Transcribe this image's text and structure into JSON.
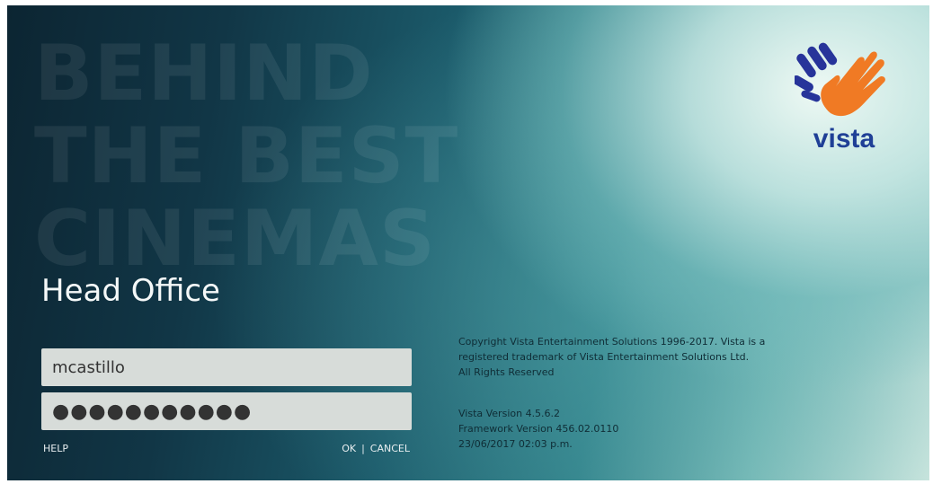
{
  "background": {
    "headline": [
      "BEHIND",
      "THE BEST",
      "CINEMAS"
    ]
  },
  "logo": {
    "icon": "vista-hands-icon",
    "text": "vista",
    "colors": {
      "orange_hand": "#f07a24",
      "blue_hand": "#27349a"
    }
  },
  "app": {
    "title": "Head Office"
  },
  "login": {
    "username_value": "mcastillo",
    "password_value": "●●●●●●●●●●●"
  },
  "actions": {
    "help_label": "HELP",
    "ok_label": "OK",
    "separator": "|",
    "cancel_label": "CANCEL"
  },
  "info": {
    "copyright_lines": [
      "Copyright Vista Entertainment Solutions 1996-2017. Vista is a",
      "registered trademark of Vista Entertainment Solutions Ltd.",
      "All Rights Reserved"
    ],
    "version_lines": [
      "Vista Version 4.5.6.2",
      "Framework Version 456.02.0110",
      "23/06/2017 02:03 p.m."
    ]
  }
}
